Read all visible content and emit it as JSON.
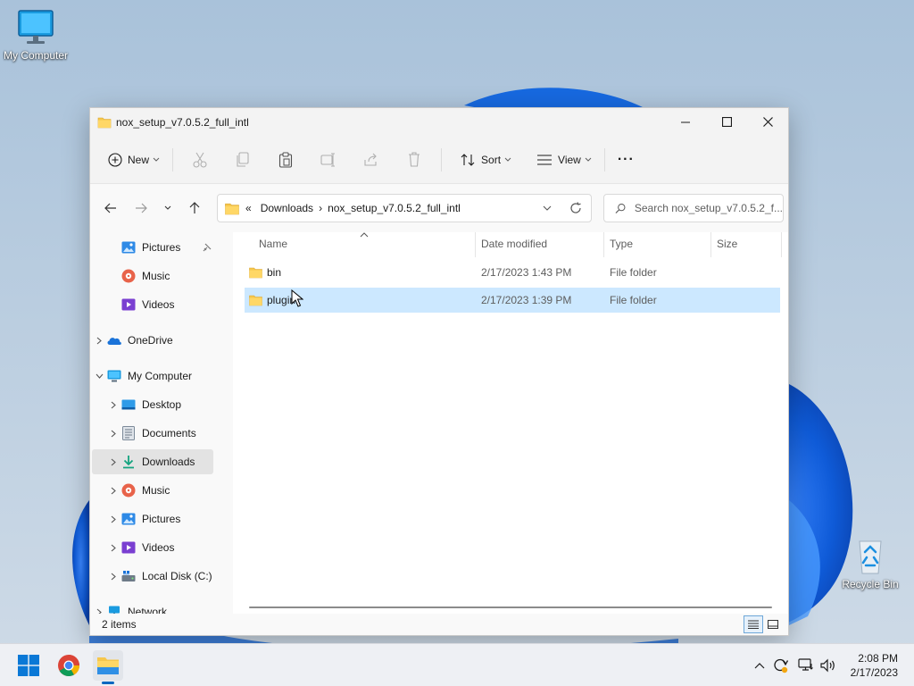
{
  "desktop": {
    "icons": [
      {
        "label": "My Computer"
      },
      {
        "label": "Recycle Bin"
      }
    ]
  },
  "window": {
    "title": "nox_setup_v7.0.5.2_full_intl"
  },
  "toolbar": {
    "new_label": "New",
    "sort_label": "Sort",
    "view_label": "View",
    "more_label": "···"
  },
  "address": {
    "overflow": "«",
    "crumbs": [
      "Downloads",
      "nox_setup_v7.0.5.2_full_intl"
    ],
    "separator": "›"
  },
  "search": {
    "placeholder": "Search nox_setup_v7.0.5.2_f..."
  },
  "navpane": {
    "items": [
      {
        "label": "Pictures",
        "icon": "pictures-icon",
        "pinned": true
      },
      {
        "label": "Music",
        "icon": "music-icon"
      },
      {
        "label": "Videos",
        "icon": "videos-icon"
      },
      {
        "label": "OneDrive",
        "icon": "onedrive-icon"
      },
      {
        "label": "My Computer",
        "icon": "computer-icon"
      },
      {
        "label": "Desktop",
        "icon": "desktop-icon"
      },
      {
        "label": "Documents",
        "icon": "documents-icon"
      },
      {
        "label": "Downloads",
        "icon": "downloads-icon",
        "selected": true
      },
      {
        "label": "Music",
        "icon": "music-icon"
      },
      {
        "label": "Pictures",
        "icon": "pictures-icon"
      },
      {
        "label": "Videos",
        "icon": "videos-icon"
      },
      {
        "label": "Local Disk (C:)",
        "icon": "drive-icon"
      },
      {
        "label": "Network",
        "icon": "network-icon"
      }
    ]
  },
  "filelist": {
    "columns": [
      "Name",
      "Date modified",
      "Type",
      "Size"
    ],
    "rows": [
      {
        "name": "bin",
        "date": "2/17/2023 1:43 PM",
        "type": "File folder",
        "size": ""
      },
      {
        "name": "plugin",
        "date": "2/17/2023 1:39 PM",
        "type": "File folder",
        "size": "",
        "selected": true
      }
    ]
  },
  "status": {
    "items": "2 items"
  },
  "taskbar": {
    "time": "2:08 PM",
    "date": "2/17/2023"
  },
  "colors": {
    "accent": "#0067c0",
    "selection": "#cce8ff",
    "folder": "#f6c74c"
  }
}
